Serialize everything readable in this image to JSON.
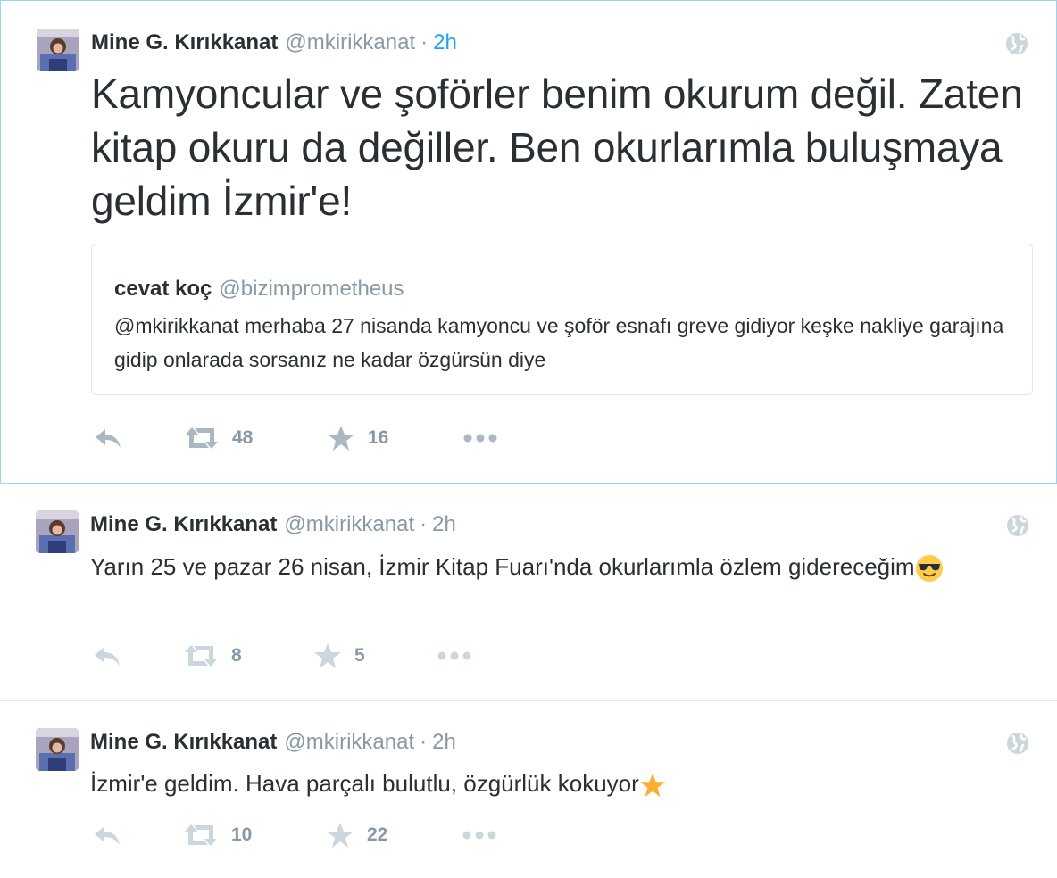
{
  "colors": {
    "link_blue": "#1da1f2",
    "meta_gray": "#8899a6",
    "text_dark": "#292f33",
    "border": "#e1e8ed",
    "selected_border": "#9bd3f2",
    "star_orange": "#ffac33"
  },
  "tweets": [
    {
      "fullname": "Mine G. Kırıkkanat",
      "username": "@mkirikkanat",
      "separator": "·",
      "time": "2h",
      "text": "Kamyoncular ve şoförler benim okurum değil. Zaten kitap okuru da değiller. Ben okurlarımla buluşmaya geldim İzmir'e!",
      "globe_icon": "globe-icon",
      "quote": {
        "fullname": "cevat koç",
        "username": "@bizimprometheus",
        "mention": "@mkirikkanat",
        "text": " merhaba 27 nisanda kamyoncu ve şoför esnafı greve gidiyor keşke nakliye garajına gidip onlarada sorsanız ne kadar özgürsün diye"
      },
      "retweets": "48",
      "likes": "16"
    },
    {
      "fullname": "Mine G. Kırıkkanat",
      "username": "@mkirikkanat",
      "separator": "·",
      "time": "2h",
      "text": "Yarın 25 ve pazar 26 nisan, İzmir Kitap Fuarı'nda okurlarımla özlem gidereceğim",
      "emoji": "smiling-face-with-sunglasses",
      "retweets": "8",
      "likes": "5"
    },
    {
      "fullname": "Mine G. Kırıkkanat",
      "username": "@mkirikkanat",
      "separator": "·",
      "time": "2h",
      "text": "İzmir'e geldim. Hava parçalı bulutlu, özgürlük kokuyor",
      "emoji": "star",
      "retweets": "10",
      "likes": "22"
    }
  ]
}
